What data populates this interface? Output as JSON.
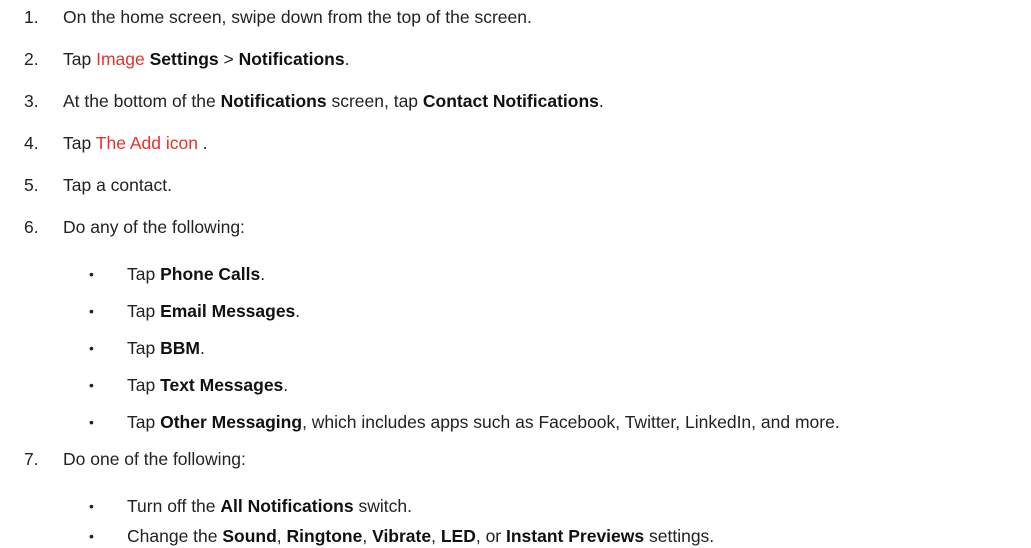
{
  "bullet_char": "•",
  "steps": [
    {
      "num": "1.",
      "parts": [
        "On the home screen, swipe down from the top of the screen."
      ]
    },
    {
      "num": "2.",
      "parts": [
        "Tap ",
        "Image",
        " ",
        "Settings",
        " > ",
        "Notifications",
        "."
      ]
    },
    {
      "num": "3.",
      "parts": [
        "At the bottom of the ",
        "Notifications",
        " screen, tap ",
        "Contact Notifications",
        "."
      ]
    },
    {
      "num": "4.",
      "parts": [
        "Tap ",
        "The Add icon",
        " ."
      ]
    },
    {
      "num": "5.",
      "parts": [
        "Tap a contact."
      ]
    },
    {
      "num": "6.",
      "parts": [
        "Do any of the following:"
      ]
    },
    {
      "num": "7.",
      "parts": [
        "Do one of the following:"
      ]
    }
  ],
  "step6_bullets": [
    [
      "Tap ",
      "Phone Calls",
      "."
    ],
    [
      "Tap ",
      "Email Messages",
      "."
    ],
    [
      "Tap ",
      "BBM",
      "."
    ],
    [
      "Tap ",
      "Text Messages",
      "."
    ],
    [
      "Tap ",
      "Other Messaging",
      ", which includes apps such as Facebook, Twitter, LinkedIn, and more."
    ]
  ],
  "step7_bullets": [
    [
      "Turn off the ",
      "All Notifications",
      " switch."
    ],
    [
      "Change the ",
      "Sound",
      ", ",
      "Ringtone",
      ", ",
      "Vibrate",
      ", ",
      "LED",
      ", or ",
      "Instant Previews",
      " settings."
    ]
  ]
}
